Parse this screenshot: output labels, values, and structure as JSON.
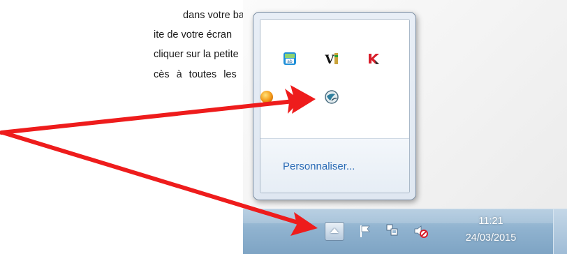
{
  "document": {
    "lines": [
      "dans votre barre",
      "ite de votre écran",
      "cliquer sur la petite",
      "cès  à  toutes  les"
    ]
  },
  "popup": {
    "customize_label": "Personnaliser...",
    "icons": [
      "dictionary-icon",
      "antivirus-v-icon",
      "kaspersky-icon",
      "orange-ball-icon",
      "globe-app-icon"
    ]
  },
  "taskbar": {
    "time": "11:21",
    "date": "24/03/2015",
    "icons": [
      "show-hidden-icons-button",
      "action-center-flag-icon",
      "network-icon",
      "volume-muted-icon"
    ]
  },
  "colors": {
    "arrow": "#ee1c1c",
    "link": "#2a6bb5",
    "taskbar": "#8fb2cf"
  }
}
